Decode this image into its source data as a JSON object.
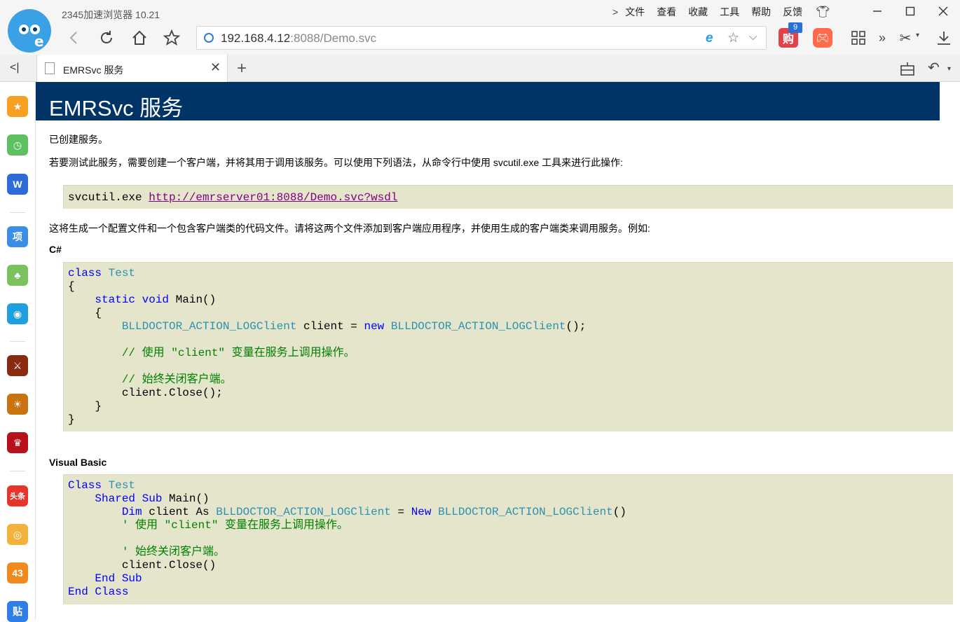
{
  "app": {
    "title": "2345加速浏览器 10.21"
  },
  "menu": {
    "items": [
      "文件",
      "查看",
      "收藏",
      "工具",
      "帮助",
      "反馈"
    ]
  },
  "address": {
    "host": "192.168.4.12",
    "rest": ":8088/Demo.svc"
  },
  "toolbar": {
    "shop_badge": "9",
    "shop_label": "购"
  },
  "tab": {
    "title": "EMRSvc 服务"
  },
  "sidebar": {
    "items": [
      {
        "name": "favorites",
        "color": "#f7a021",
        "glyph": "★"
      },
      {
        "name": "history",
        "color": "#5cc15f",
        "glyph": "◷"
      },
      {
        "name": "word",
        "color": "#2f6bd8",
        "glyph": "W"
      },
      {
        "name": "project",
        "color": "#3a8ee6",
        "glyph": "项"
      },
      {
        "name": "cactus",
        "color": "#7cc160",
        "glyph": "♣"
      },
      {
        "name": "bird",
        "color": "#1e9fe0",
        "glyph": "◉"
      },
      {
        "name": "game1",
        "color": "#8a2a10",
        "glyph": "⚔"
      },
      {
        "name": "game2",
        "color": "#c77312",
        "glyph": "☀"
      },
      {
        "name": "game3",
        "color": "#b8111c",
        "glyph": "♛"
      },
      {
        "name": "toutiao",
        "color": "#e8352c",
        "glyph": "头条"
      },
      {
        "name": "weibo",
        "color": "#f3b23c",
        "glyph": "◎"
      },
      {
        "name": "4399",
        "color": "#f08a1c",
        "glyph": "43"
      },
      {
        "name": "tieba",
        "color": "#2f7ee6",
        "glyph": "贴"
      }
    ]
  },
  "page": {
    "heading": "EMRSvc 服务",
    "p1": "已创建服务。",
    "p2": "若要测试此服务，需要创建一个客户端，并将其用于调用该服务。可以使用下列语法，从命令行中使用 svcutil.exe 工具来进行此操作:",
    "svcutil_cmd": "svcutil.exe ",
    "svcutil_url": "http://emrserver01:8088/Demo.svc?wsdl",
    "p3": "这将生成一个配置文件和一个包含客户端类的代码文件。请将这两个文件添加到客户端应用程序，并使用生成的客户端类来调用服务。例如:",
    "cs_heading": "C#",
    "vb_heading": "Visual Basic",
    "client_class": "BLLDOCTOR_ACTION_LOGClient",
    "cs_comment1": "// 使用 \"client\" 变量在服务上调用操作。",
    "cs_comment2": "// 始终关闭客户端。",
    "vb_comment1": "' 使用 \"client\" 变量在服务上调用操作。",
    "vb_comment2": "' 始终关闭客户端。"
  }
}
